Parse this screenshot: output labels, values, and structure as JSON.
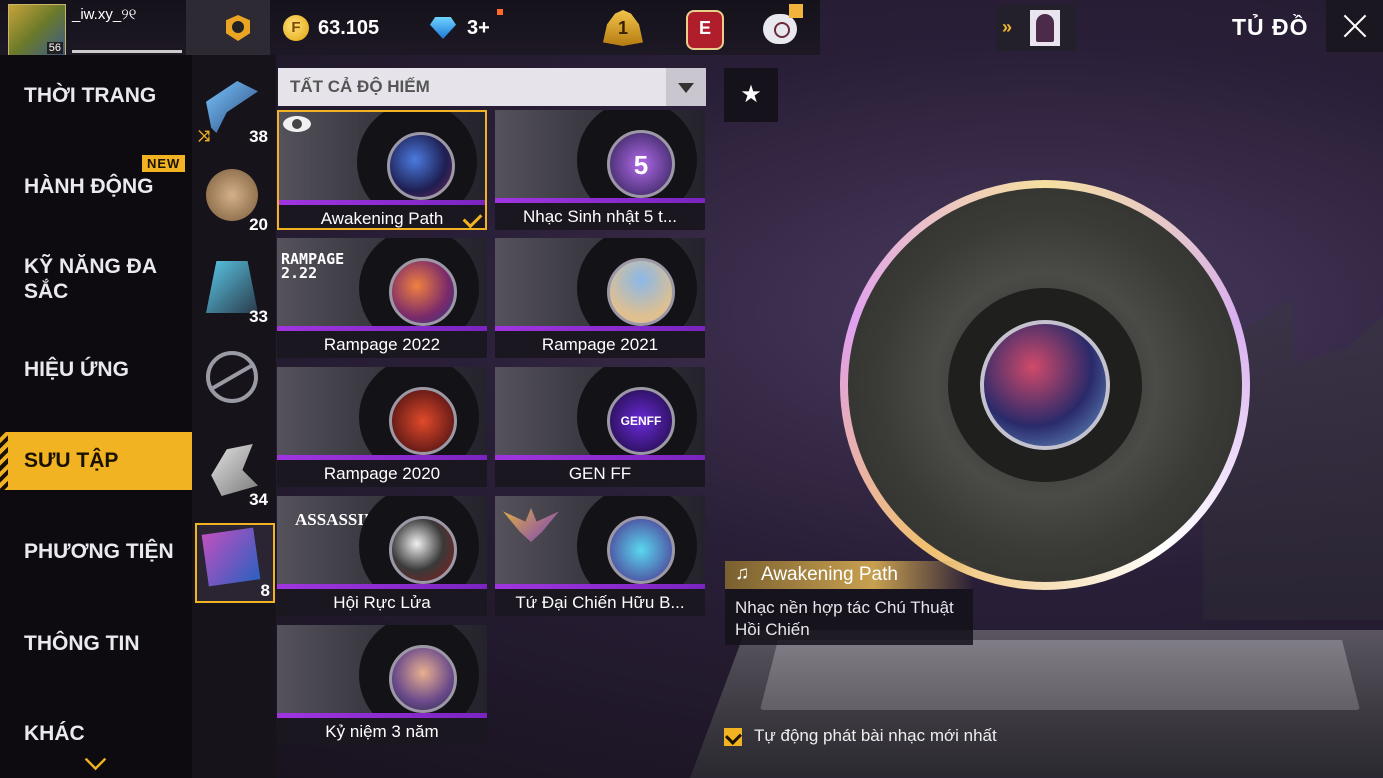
{
  "player": {
    "name": "_iw.xy_୨୧",
    "level": "56"
  },
  "currency": {
    "coins": "63.105",
    "diamonds": "3+",
    "coin_symbol": "F"
  },
  "top_icons": {
    "rank_number": "1",
    "event_letter": "E"
  },
  "header": {
    "title": "TỦ ĐỒ"
  },
  "nav": {
    "new_badge": "NEW",
    "items": [
      {
        "label": "THỜI TRANG"
      },
      {
        "label": "HÀNH ĐỘNG"
      },
      {
        "label": "KỸ NĂNG ĐA SẮC"
      },
      {
        "label": "HIỆU ỨNG"
      },
      {
        "label": "SƯU TẬP"
      },
      {
        "label": "PHƯƠNG TIỆN"
      },
      {
        "label": "THÔNG TIN"
      },
      {
        "label": "KHÁC"
      }
    ],
    "active": "SƯU TẬP"
  },
  "categories": [
    {
      "count": "38",
      "icon": "pickaxe-icon"
    },
    {
      "count": "20",
      "icon": "piggy-icon"
    },
    {
      "count": "33",
      "icon": "card-icon"
    },
    {
      "count": "",
      "icon": "none-icon"
    },
    {
      "count": "34",
      "icon": "gear-icon"
    },
    {
      "count": "8",
      "icon": "music-album-icon"
    }
  ],
  "filter": {
    "label": "TẤT CẢ ĐỘ HIẾM"
  },
  "tracks": [
    {
      "name": "Awakening Path",
      "selected": true
    },
    {
      "name": "Nhạc Sinh nhật 5 t...",
      "disc_text": "5"
    },
    {
      "name": "Rampage 2022",
      "logo": "RAMPAGE\n2.22"
    },
    {
      "name": "Rampage 2021"
    },
    {
      "name": "Rampage 2020"
    },
    {
      "name": "GEN FF",
      "disc_text": "GENFF"
    },
    {
      "name": "Hội Rực Lửa",
      "logo": "ASSASSIN'S"
    },
    {
      "name": "Tứ Đại Chiến Hữu B..."
    },
    {
      "name": "Kỷ niệm 3 năm"
    }
  ],
  "preview": {
    "title": "Awakening Path",
    "description": "Nhạc nền hợp tác Chú Thuật Hồi Chiến"
  },
  "autoplay": {
    "label": "Tự động phát bài nhạc mới nhất",
    "checked": true
  },
  "colors": {
    "accent": "#f2b322",
    "rarity_bar": "#a035e0"
  }
}
